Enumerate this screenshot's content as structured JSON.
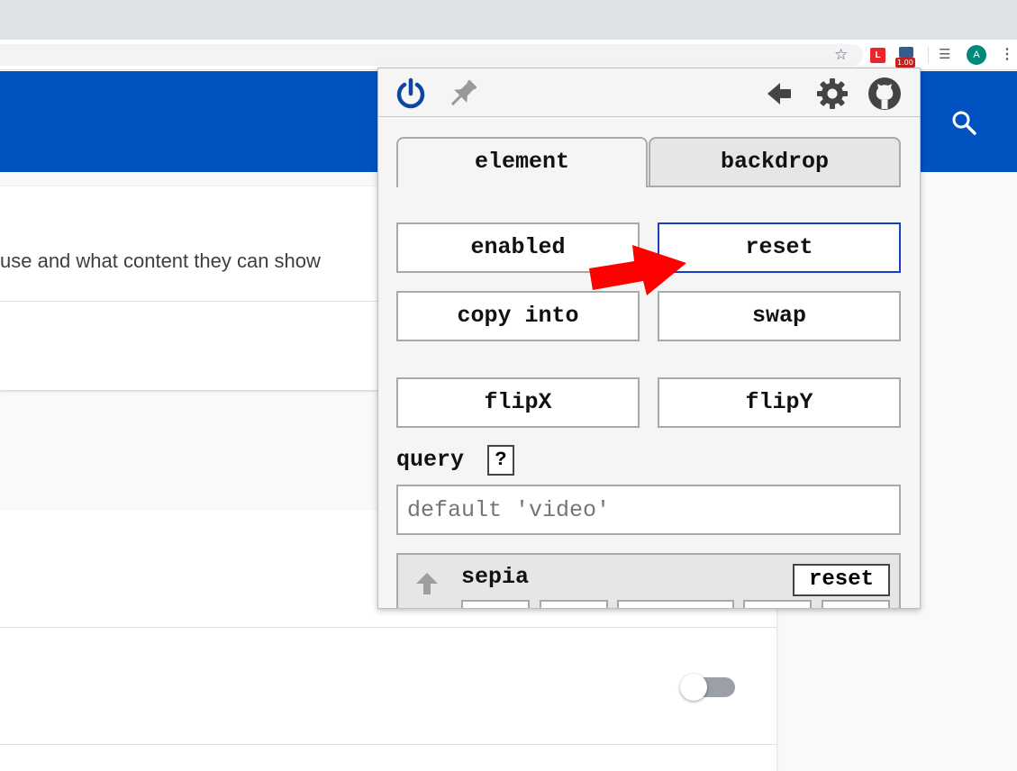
{
  "browser": {
    "profile_initial": "A",
    "extension_l_label": "L",
    "extension_badge": "1.00"
  },
  "page": {
    "description_text": "use and what content they can show"
  },
  "popup": {
    "tabs": {
      "element": "element",
      "backdrop": "backdrop"
    },
    "buttons": {
      "enabled": "enabled",
      "reset": "reset",
      "copy_into": "copy into",
      "swap": "swap",
      "flipx": "flipX",
      "flipy": "flipY"
    },
    "query": {
      "label": "query",
      "help": "?",
      "placeholder": "default 'video'",
      "value": ""
    },
    "filter": {
      "name": "sepia",
      "reset": "reset"
    }
  },
  "colors": {
    "header_blue": "#0052c1",
    "power_blue": "#0d47a1",
    "arrow_red": "#ff0000",
    "focus_border": "#1a3fc7"
  },
  "icons": [
    "power-icon",
    "pin-icon",
    "back-arrow-icon",
    "gear-icon",
    "github-icon",
    "search-icon",
    "star-icon",
    "arrow-up-icon"
  ]
}
